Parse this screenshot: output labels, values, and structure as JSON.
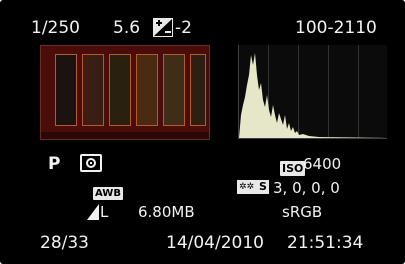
{
  "top": {
    "shutter": "1/250",
    "aperture": "5.6",
    "exposure_comp_icon": "exposure-compensation-icon",
    "exposure_comp": "-2",
    "folder_file": "100-2110"
  },
  "mode": {
    "shooting_mode": "P",
    "metering_icon": "evaluative-metering-icon",
    "iso_label": "ISO",
    "iso_value": "6400",
    "white_balance": "AWB",
    "picture_style_label": "S",
    "picture_style_values": "3,  0,  0,  0"
  },
  "file": {
    "quality_icon": "large-fine-quality-icon",
    "quality": "L",
    "size": "6.80MB",
    "color_space": "sRGB"
  },
  "bottom": {
    "image_counter": "28/33",
    "date": "14/04/2010",
    "time": "21:51:34"
  },
  "colors": {
    "screen_bg": "#000000",
    "text": "#f2f2f2",
    "histogram": "#e6e6c8",
    "thumbnail_bg": "#4a0d0a"
  }
}
